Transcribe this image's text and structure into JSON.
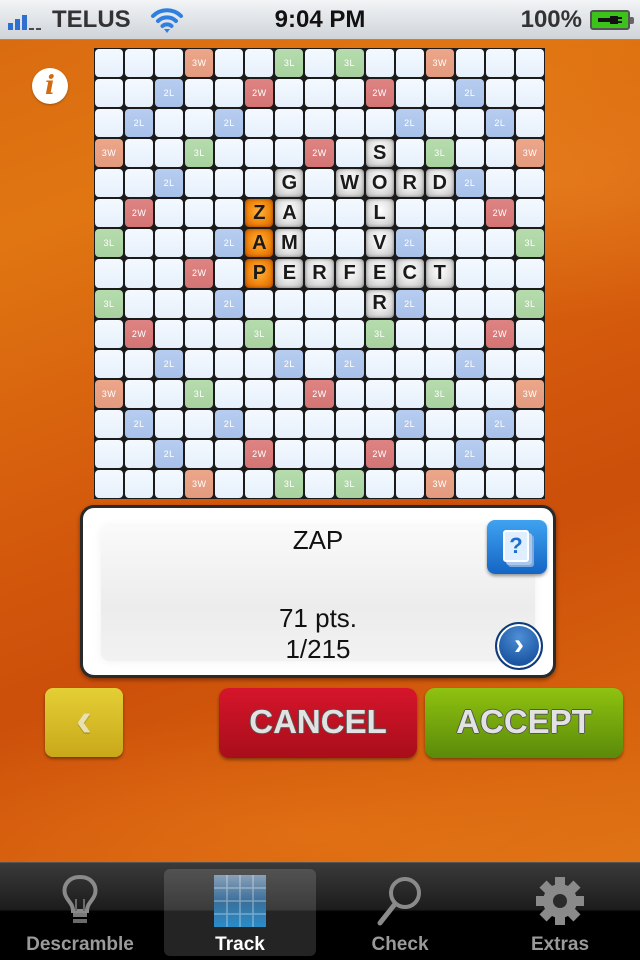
{
  "status_bar": {
    "carrier": "TELUS",
    "time": "9:04 PM",
    "battery": "100%",
    "signal_bars": 3,
    "signal_bars_total": 5
  },
  "info_button": {
    "icon": "info-icon",
    "glyph": "i"
  },
  "board": {
    "size": 15,
    "premium_labels": {
      "tw": "3W",
      "dw": "2W",
      "tl": "3L",
      "dl": "2L"
    },
    "premium_rows": [
      "...T..t.t..T...",
      "..d..D...D..d..",
      ".d..d.....d..d.",
      "T..t...D...t..T",
      "..d.........d..",
      ".D...........D.",
      "t...d.....d...t",
      "...D...........",
      "t...d.....d...t",
      ".D...t...t...D.",
      "..d...d.d...d..",
      "T..t...D...t..T",
      ".d..d.....d..d.",
      "..d..D...D..d..",
      "...T..t.t..T..."
    ],
    "premium_legend": {
      "T": "tw",
      "D": "dw",
      "t": "tl",
      "d": "dl"
    },
    "tiles": [
      {
        "row": 3,
        "col": 9,
        "letter": "S",
        "new": false
      },
      {
        "row": 4,
        "col": 6,
        "letter": "G",
        "new": false
      },
      {
        "row": 4,
        "col": 8,
        "letter": "W",
        "new": false
      },
      {
        "row": 4,
        "col": 9,
        "letter": "O",
        "new": false
      },
      {
        "row": 4,
        "col": 10,
        "letter": "R",
        "new": false
      },
      {
        "row": 4,
        "col": 11,
        "letter": "D",
        "new": false
      },
      {
        "row": 5,
        "col": 5,
        "letter": "Z",
        "new": true
      },
      {
        "row": 5,
        "col": 6,
        "letter": "A",
        "new": false
      },
      {
        "row": 5,
        "col": 9,
        "letter": "L",
        "new": false
      },
      {
        "row": 6,
        "col": 5,
        "letter": "A",
        "new": true
      },
      {
        "row": 6,
        "col": 6,
        "letter": "M",
        "new": false
      },
      {
        "row": 6,
        "col": 9,
        "letter": "V",
        "new": false
      },
      {
        "row": 7,
        "col": 5,
        "letter": "P",
        "new": true
      },
      {
        "row": 7,
        "col": 6,
        "letter": "E",
        "new": false
      },
      {
        "row": 7,
        "col": 7,
        "letter": "R",
        "new": false
      },
      {
        "row": 7,
        "col": 8,
        "letter": "F",
        "new": false
      },
      {
        "row": 7,
        "col": 9,
        "letter": "E",
        "new": false
      },
      {
        "row": 7,
        "col": 10,
        "letter": "C",
        "new": false
      },
      {
        "row": 7,
        "col": 11,
        "letter": "T",
        "new": false
      },
      {
        "row": 8,
        "col": 9,
        "letter": "R",
        "new": false
      }
    ]
  },
  "result": {
    "word": "ZAP",
    "points": "71 pts.",
    "index": "1/215",
    "define_icon": "dictionary-question-icon",
    "define_glyph": "?",
    "next_icon": "chevron-right-icon",
    "next_glyph": "›"
  },
  "actions": {
    "back_glyph": "‹",
    "cancel_label": "CANCEL",
    "accept_label": "ACCEPT"
  },
  "tabs": [
    {
      "label": "Descramble",
      "icon": "lightbulb-icon",
      "active": false
    },
    {
      "label": "Track",
      "icon": "board-grid-icon",
      "active": true
    },
    {
      "label": "Check",
      "icon": "magnifier-icon",
      "active": false
    },
    {
      "label": "Extras",
      "icon": "gear-icon",
      "active": false
    }
  ],
  "colors": {
    "background": "#d8600e",
    "tile_new": "#f28a10",
    "tw": "#e39a7e",
    "dw": "#d47474",
    "tl": "#a7d19e",
    "dl": "#a8c1ea",
    "cancel": "#c0121f",
    "accept": "#6fa00c"
  }
}
